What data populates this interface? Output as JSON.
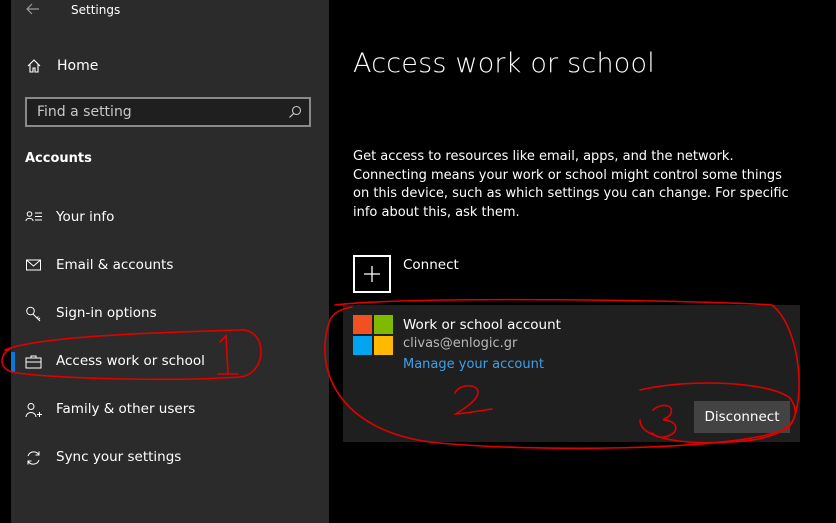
{
  "window": {
    "title": "Settings"
  },
  "sidebar": {
    "home_label": "Home",
    "search": {
      "placeholder": "Find a setting"
    },
    "section_label": "Accounts",
    "items": [
      {
        "label": "Your info",
        "icon": "person-list-icon"
      },
      {
        "label": "Email & accounts",
        "icon": "mail-icon"
      },
      {
        "label": "Sign-in options",
        "icon": "key-icon"
      },
      {
        "label": "Access work or school",
        "icon": "briefcase-icon",
        "selected": true
      },
      {
        "label": "Family & other users",
        "icon": "person-add-icon"
      },
      {
        "label": "Sync your settings",
        "icon": "sync-icon"
      }
    ]
  },
  "main": {
    "title": "Access work or school",
    "description": "Get access to resources like email, apps, and the network. Connecting means your work or school might control some things on this device, such as which settings you can change. For specific info about this, ask them.",
    "connect_label": "Connect",
    "account": {
      "title": "Work or school account",
      "email": "clivas@enlogic.gr",
      "manage_link": "Manage your account",
      "disconnect_label": "Disconnect"
    }
  },
  "annotations": {
    "marks": [
      "1",
      "2",
      "3"
    ],
    "color": "#e00000"
  },
  "colors": {
    "sidebar_bg": "#2b2b2b",
    "main_bg": "#000000",
    "card_bg": "#1f1f1f",
    "link": "#3fa0e8",
    "accent": "#0a78d4",
    "ms_red": "#f25022",
    "ms_green": "#7fba00",
    "ms_blue": "#00a4ef",
    "ms_yellow": "#ffb900"
  }
}
